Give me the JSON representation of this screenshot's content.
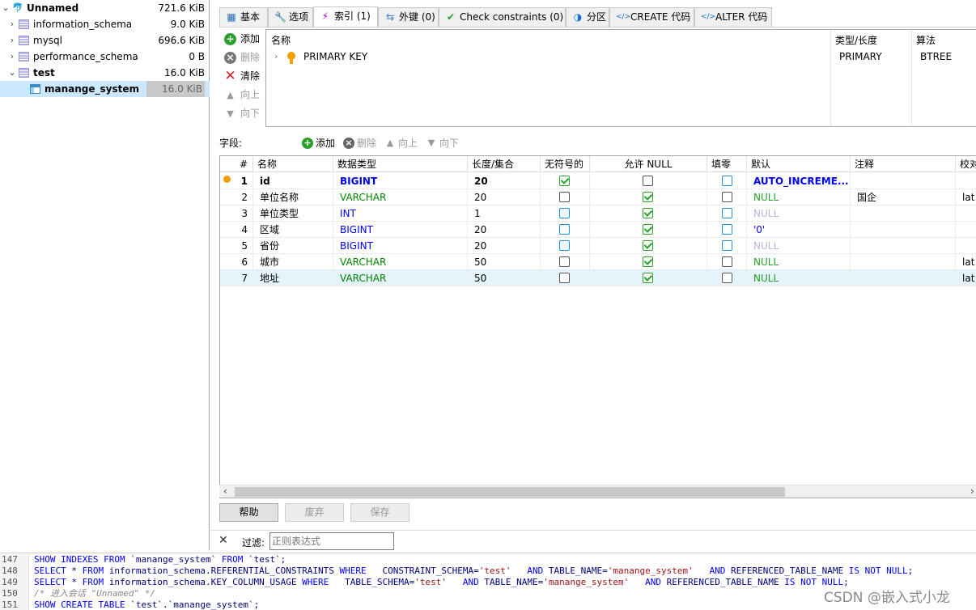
{
  "tree": [
    {
      "name": "Unnamed",
      "size": "721.6 KiB",
      "level": 0,
      "bold": true,
      "expanded": true,
      "icon": "server-icon"
    },
    {
      "name": "information_schema",
      "size": "9.0 KiB",
      "level": 1,
      "bold": false,
      "expanded": false,
      "icon": "database-icon"
    },
    {
      "name": "mysql",
      "size": "696.6 KiB",
      "level": 1,
      "bold": false,
      "expanded": false,
      "icon": "database-icon"
    },
    {
      "name": "performance_schema",
      "size": "0 B",
      "level": 1,
      "bold": false,
      "expanded": false,
      "icon": "database-icon"
    },
    {
      "name": "test",
      "size": "16.0 KiB",
      "level": 1,
      "bold": true,
      "expanded": true,
      "icon": "database-icon"
    },
    {
      "name": "manange_system",
      "size": "16.0 KiB",
      "level": 2,
      "bold": true,
      "selected": true,
      "icon": "table-icon"
    }
  ],
  "tabs": [
    {
      "label": "基本",
      "icon": "table-icon"
    },
    {
      "label": "选项",
      "icon": "wrench-icon"
    },
    {
      "label": "索引 (1)",
      "icon": "lightning-icon",
      "active": true
    },
    {
      "label": "外键 (0)",
      "icon": "foreign-key-icon"
    },
    {
      "label": "Check constraints (0)",
      "icon": "check-icon"
    },
    {
      "label": "分区",
      "icon": "partition-icon"
    },
    {
      "label": "CREATE 代码",
      "icon": "code-icon"
    },
    {
      "label": "ALTER 代码",
      "icon": "code-icon"
    }
  ],
  "index_panel": {
    "buttons": {
      "add": "添加",
      "delete": "删除",
      "clear": "清除",
      "up": "向上",
      "down": "向下"
    },
    "headers": {
      "name": "名称",
      "type": "类型/长度",
      "algorithm": "算法"
    },
    "row": {
      "name": "PRIMARY KEY",
      "type": "PRIMARY",
      "algorithm": "BTREE"
    }
  },
  "fields_toolbar": {
    "label": "字段:",
    "add": "添加",
    "delete": "删除",
    "up": "向上",
    "down": "向下"
  },
  "columns_header": [
    "#",
    "名称",
    "数据类型",
    "长度/集合",
    "无符号的",
    "允许 NULL",
    "填零",
    "默认",
    "注释",
    "校对"
  ],
  "columns": [
    {
      "num": "1",
      "name": "id",
      "type": "BIGINT",
      "length": "20",
      "unsigned": true,
      "nullable": false,
      "zerofill": false,
      "default": "AUTO_INCREME...",
      "comment": "",
      "collation": "",
      "pk": true,
      "type_color": "#0000ff"
    },
    {
      "num": "2",
      "name": "单位名称",
      "type": "VARCHAR",
      "length": "20",
      "unsigned": false,
      "nullable": true,
      "zerofill": false,
      "default": "NULL",
      "comment": "国企",
      "collation": "lat",
      "type_color": "#008000"
    },
    {
      "num": "3",
      "name": "单位类型",
      "type": "INT",
      "length": "1",
      "unsigned": false,
      "nullable": true,
      "zerofill": false,
      "default": "NULL",
      "comment": "",
      "collation": "",
      "type_color": "#0000ff",
      "default_dim": true
    },
    {
      "num": "4",
      "name": "区域",
      "type": "BIGINT",
      "length": "20",
      "unsigned": false,
      "nullable": true,
      "zerofill": false,
      "default": "'0'",
      "comment": "",
      "collation": "",
      "type_color": "#0000ff"
    },
    {
      "num": "5",
      "name": "省份",
      "type": "BIGINT",
      "length": "20",
      "unsigned": false,
      "nullable": true,
      "zerofill": false,
      "default": "NULL",
      "comment": "",
      "collation": "",
      "type_color": "#0000ff",
      "default_dim": true
    },
    {
      "num": "6",
      "name": "城市",
      "type": "VARCHAR",
      "length": "50",
      "unsigned": false,
      "nullable": true,
      "zerofill": false,
      "default": "NULL",
      "comment": "",
      "collation": "lat",
      "type_color": "#008000"
    },
    {
      "num": "7",
      "name": "地址",
      "type": "VARCHAR",
      "length": "50",
      "unsigned": false,
      "nullable": true,
      "zerofill": false,
      "default": "NULL",
      "comment": "",
      "collation": "lat",
      "type_color": "#008000",
      "selected": true
    }
  ],
  "bottom_buttons": {
    "help": "帮助",
    "discard": "废弃",
    "save": "保存"
  },
  "filter": {
    "label": "过滤:",
    "placeholder": "正则表达式"
  },
  "sql_log": [
    {
      "num": "147",
      "text": "SHOW INDEXES FROM `manange_system` FROM `test`;"
    },
    {
      "num": "148",
      "text": "SELECT * FROM information_schema.REFERENTIAL_CONSTRAINTS WHERE   CONSTRAINT_SCHEMA='test'   AND TABLE_NAME='manange_system'   AND REFERENCED_TABLE_NAME IS NOT NULL;"
    },
    {
      "num": "149",
      "text": "SELECT * FROM information_schema.KEY_COLUMN_USAGE WHERE   TABLE_SCHEMA='test'   AND TABLE_NAME='manange_system'   AND REFERENCED_TABLE_NAME IS NOT NULL;"
    },
    {
      "num": "150",
      "text": "/* 进入会话 \"Unnamed\" */",
      "comment": true
    },
    {
      "num": "151",
      "text": "SHOW CREATE TABLE `test`.`manange_system`;"
    }
  ],
  "watermark": "CSDN @嵌入式小龙",
  "colors": {
    "accent": "#0000ff",
    "green": "#008000",
    "selection": "#cce8ff",
    "row_selected": "#e5f3fb"
  }
}
